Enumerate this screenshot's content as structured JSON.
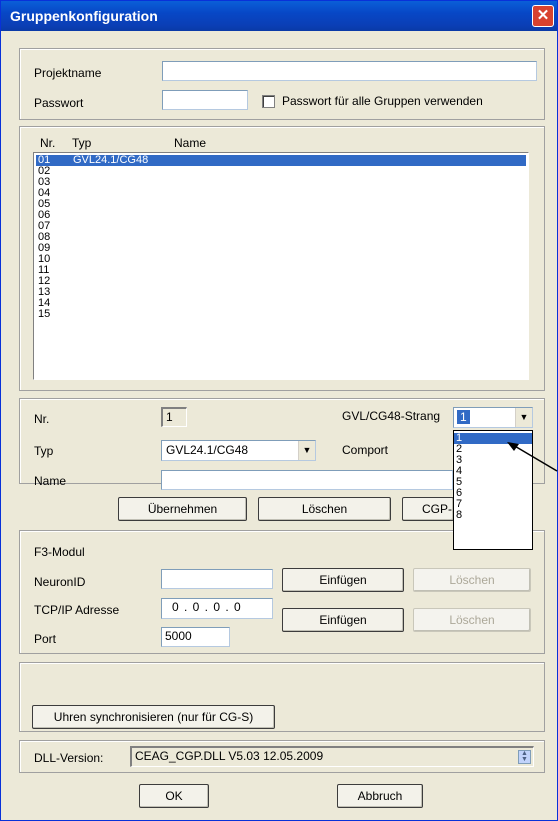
{
  "window": {
    "title": "Gruppenkonfiguration",
    "close_label": "✕"
  },
  "project": {
    "name_label": "Projektname",
    "name_value": "",
    "password_label": "Passwort",
    "password_value": "",
    "use_for_all_label": "Passwort für alle Gruppen verwenden"
  },
  "list": {
    "headers": {
      "nr": "Nr.",
      "typ": "Typ",
      "name": "Name"
    },
    "rows": [
      {
        "nr": "01",
        "typ": "GVL24.1/CG48",
        "name": "",
        "selected": true
      },
      {
        "nr": "02",
        "typ": "",
        "name": ""
      },
      {
        "nr": "03",
        "typ": "",
        "name": ""
      },
      {
        "nr": "04",
        "typ": "",
        "name": ""
      },
      {
        "nr": "05",
        "typ": "",
        "name": ""
      },
      {
        "nr": "06",
        "typ": "",
        "name": ""
      },
      {
        "nr": "07",
        "typ": "",
        "name": ""
      },
      {
        "nr": "08",
        "typ": "",
        "name": ""
      },
      {
        "nr": "09",
        "typ": "",
        "name": ""
      },
      {
        "nr": "10",
        "typ": "",
        "name": ""
      },
      {
        "nr": "11",
        "typ": "",
        "name": ""
      },
      {
        "nr": "12",
        "typ": "",
        "name": ""
      },
      {
        "nr": "13",
        "typ": "",
        "name": ""
      },
      {
        "nr": "14",
        "typ": "",
        "name": ""
      },
      {
        "nr": "15",
        "typ": "",
        "name": ""
      }
    ]
  },
  "detail": {
    "nr_label": "Nr.",
    "nr_value": "1",
    "strang_label": "GVL/CG48-Strang",
    "strang_value": "1",
    "strang_options": [
      "1",
      "2",
      "3",
      "4",
      "5",
      "6",
      "7",
      "8"
    ],
    "strang_selected": "1",
    "typ_label": "Typ",
    "typ_value": "GVL24.1/CG48",
    "comport_label": "Comport",
    "name_label": "Name",
    "name_value": "",
    "btn_apply": "Übernehmen",
    "btn_delete": "Löschen",
    "btn_cgp": "CGP-"
  },
  "f3": {
    "title": "F3-Modul",
    "neuron_label": "NeuronID",
    "neuron_value": "",
    "neuron_insert": "Einfügen",
    "neuron_delete": "Löschen",
    "tcp_label": "TCP/IP Adresse",
    "tcp_value": "0 . 0 . 0 . 0",
    "tcp_insert": "Einfügen",
    "tcp_delete": "Löschen",
    "port_label": "Port",
    "port_value": "5000"
  },
  "sync": {
    "button": "Uhren synchronisieren (nur für CG-S)"
  },
  "dll": {
    "label": "DLL-Version:",
    "value": "CEAG_CGP.DLL V5.03 12.05.2009"
  },
  "footer": {
    "ok": "OK",
    "cancel": "Abbruch"
  }
}
